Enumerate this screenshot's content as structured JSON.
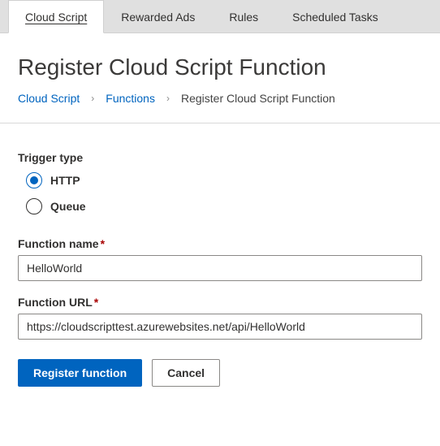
{
  "tabs": {
    "items": [
      {
        "label": "Cloud Script",
        "active": true
      },
      {
        "label": "Rewarded Ads",
        "active": false
      },
      {
        "label": "Rules",
        "active": false
      },
      {
        "label": "Scheduled Tasks",
        "active": false
      }
    ]
  },
  "page": {
    "title": "Register Cloud Script Function"
  },
  "breadcrumbs": {
    "items": [
      {
        "label": "Cloud Script",
        "link": true
      },
      {
        "label": "Functions",
        "link": true
      },
      {
        "label": "Register Cloud Script Function",
        "link": false
      }
    ],
    "separator": "›"
  },
  "form": {
    "trigger_label": "Trigger type",
    "trigger_options": [
      {
        "label": "HTTP",
        "selected": true
      },
      {
        "label": "Queue",
        "selected": false
      }
    ],
    "name_label": "Function name",
    "name_value": "HelloWorld",
    "url_label": "Function URL",
    "url_value": "https://cloudscripttest.azurewebsites.net/api/HelloWorld",
    "required_mark": "*"
  },
  "actions": {
    "primary": "Register function",
    "secondary": "Cancel"
  }
}
